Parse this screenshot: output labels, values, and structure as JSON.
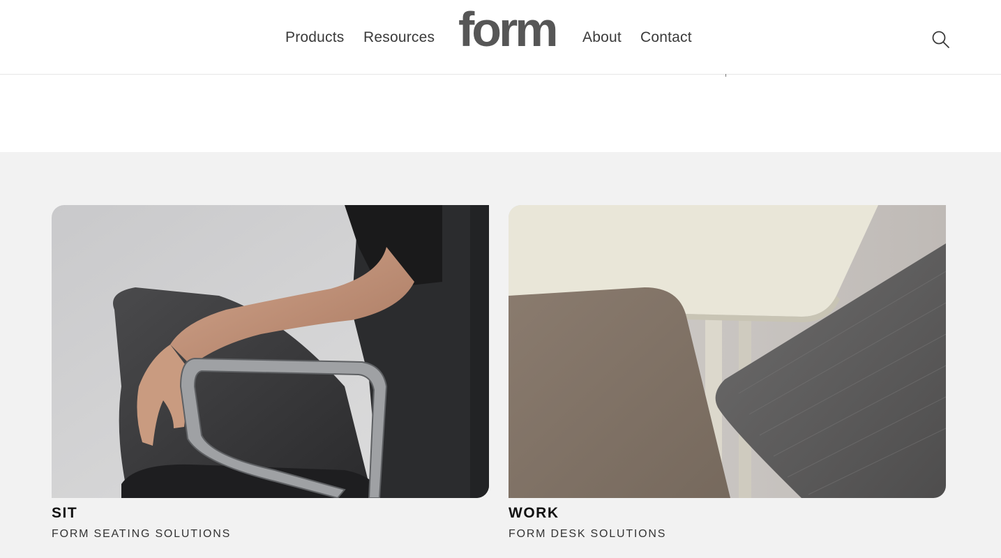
{
  "header": {
    "logo": "form",
    "nav_left": [
      "Products",
      "Resources"
    ],
    "nav_right": [
      "About",
      "Contact"
    ],
    "search_icon": "search-icon"
  },
  "cards": [
    {
      "title": "SIT",
      "subtitle": "FORM SEATING SOLUTIONS",
      "image": "person seated in black office chair with chrome arm"
    },
    {
      "title": "WORK",
      "subtitle": "FORM DESK SOLUTIONS",
      "image": "overlapping desk tops in cream, taupe and grey woodgrain"
    }
  ],
  "colors": {
    "header_bg": "#ffffff",
    "page_bg": "#f2f2f2",
    "logo": "#565656",
    "nav_text": "#3a3a3a"
  }
}
